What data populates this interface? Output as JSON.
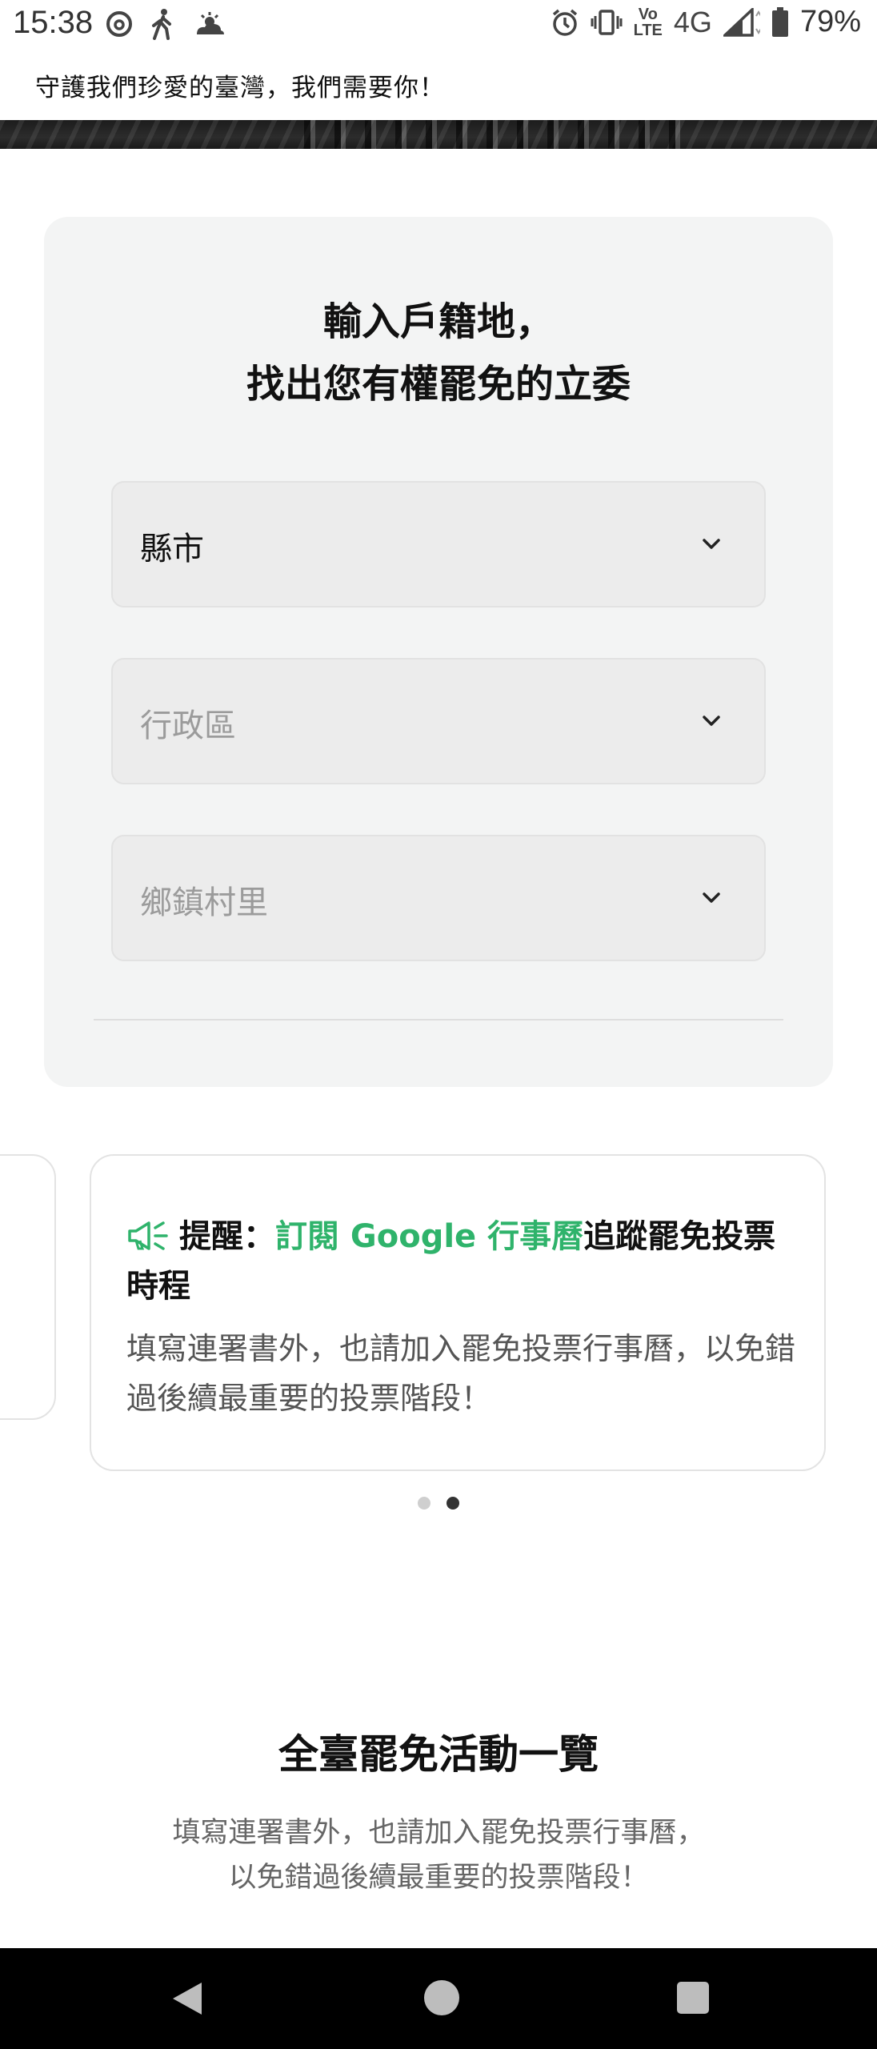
{
  "status_bar": {
    "time": "15:38",
    "network": "4G",
    "volte": "Vo\nLTE",
    "battery_percent": "79%",
    "icons": [
      "threads-icon",
      "walking-icon",
      "weather-icon",
      "alarm-icon",
      "vibrate-icon",
      "volte-icon",
      "signal-icon",
      "battery-icon"
    ]
  },
  "marquee": {
    "text": "守護我們珍愛的臺灣，我們需要你！"
  },
  "lookup": {
    "title_line1": "輸入戶籍地，",
    "title_line2": "找出您有權罷免的立委",
    "selects": [
      {
        "label": "縣市",
        "state": "active"
      },
      {
        "label": "行政區",
        "state": "disabled"
      },
      {
        "label": "鄉鎮村里",
        "state": "disabled"
      }
    ]
  },
  "reminder": {
    "prefix": "提醒：",
    "link": "訂閱 Google 行事曆",
    "suffix": "追蹤罷免投票時程",
    "body": "填寫連署書外，也請加入罷免投票行事曆，以免錯過後續最重要的投票階段！",
    "accent_color": "#2fb36b"
  },
  "carousel": {
    "page_count": 2,
    "active_index": 1
  },
  "section": {
    "title": "全臺罷免活動一覽",
    "sub_line1": "填寫連署書外，也請加入罷免投票行事曆，",
    "sub_line2": "以免錯過後續最重要的投票階段！"
  },
  "nav": {
    "icons": [
      "back-icon",
      "home-icon",
      "recents-icon"
    ]
  }
}
